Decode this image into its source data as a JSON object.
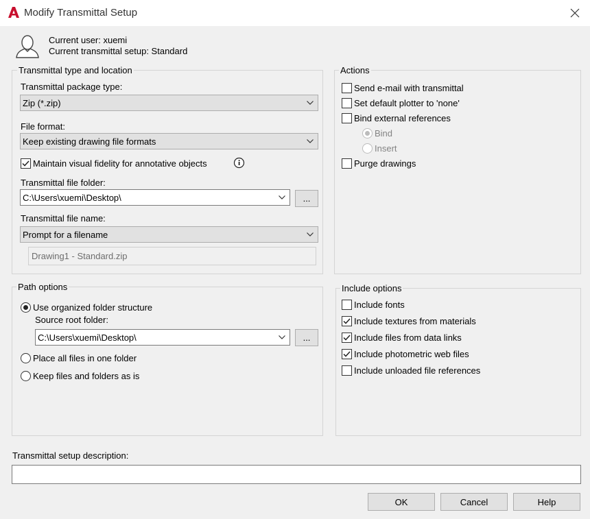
{
  "window": {
    "title": "Modify Transmittal Setup",
    "logo_letter": "A"
  },
  "header": {
    "current_user": "Current user: xuemi",
    "current_setup": "Current transmittal setup: Standard"
  },
  "transmittal_group": {
    "title": "Transmittal type and location",
    "package_type_label": "Transmittal package type:",
    "package_type_value": "Zip (*.zip)",
    "file_format_label": "File format:",
    "file_format_value": "Keep existing drawing file formats",
    "fidelity_label": "Maintain visual fidelity for annotative objects",
    "fidelity_checked": true,
    "folder_label": "Transmittal file folder:",
    "folder_value": "C:\\Users\\xuemi\\Desktop\\",
    "browse_label": "...",
    "filename_label": "Transmittal file name:",
    "filename_value": "Prompt for a filename",
    "filename_preview": "Drawing1 - Standard.zip"
  },
  "actions_group": {
    "title": "Actions",
    "send_email": "Send e-mail with transmittal",
    "default_plotter": "Set default plotter to 'none'",
    "bind_xrefs": "Bind external references",
    "bind_option": "Bind",
    "insert_option": "Insert",
    "purge": "Purge drawings"
  },
  "path_group": {
    "title": "Path options",
    "organized": "Use organized folder structure",
    "source_root_label": "Source root folder:",
    "source_root_value": "C:\\Users\\xuemi\\Desktop\\",
    "browse_label": "...",
    "one_folder": "Place all files in one folder",
    "keep_as_is": "Keep files and folders as is"
  },
  "include_group": {
    "title": "Include options",
    "items": [
      {
        "label": "Include fonts",
        "checked": false
      },
      {
        "label": "Include textures from materials",
        "checked": true
      },
      {
        "label": "Include files from data links",
        "checked": true
      },
      {
        "label": "Include photometric web files",
        "checked": true
      },
      {
        "label": "Include unloaded file references",
        "checked": false
      }
    ]
  },
  "description": {
    "label": "Transmittal setup description:",
    "value": ""
  },
  "buttons": {
    "ok": "OK",
    "cancel": "Cancel",
    "help": "Help"
  },
  "colors": {
    "logo_red": "#c8102e",
    "dialog_bg": "#f0f0f0",
    "button_bg": "#e1e1e1"
  }
}
